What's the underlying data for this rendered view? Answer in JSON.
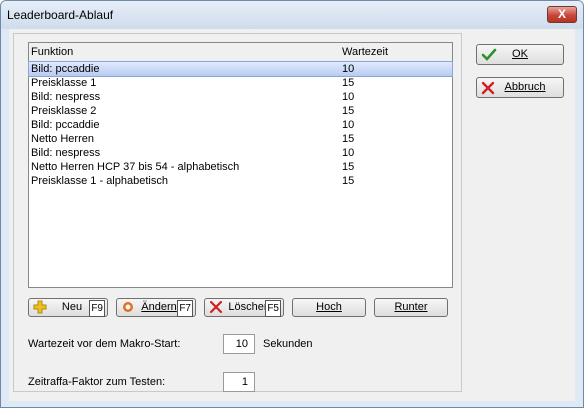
{
  "window": {
    "title": "Leaderboard-Ablauf",
    "close_label": "X"
  },
  "list": {
    "columns": [
      "Funktion",
      "Wartezeit"
    ],
    "rows": [
      {
        "funktion": "Bild: pccaddie",
        "wartezeit": "10",
        "selected": true
      },
      {
        "funktion": "Preisklasse 1",
        "wartezeit": "15"
      },
      {
        "funktion": "Bild: nespress",
        "wartezeit": "10"
      },
      {
        "funktion": "Preisklasse 2",
        "wartezeit": "15"
      },
      {
        "funktion": "Bild: pccaddie",
        "wartezeit": "10"
      },
      {
        "funktion": "Netto Herren",
        "wartezeit": "15"
      },
      {
        "funktion": "Bild: nespress",
        "wartezeit": "10"
      },
      {
        "funktion": "Netto Herren HCP 37 bis 54 - alphabetisch",
        "wartezeit": "15"
      },
      {
        "funktion": "Preisklasse 1 - alphabetisch",
        "wartezeit": "15"
      }
    ]
  },
  "buttons": {
    "neu": "Neu",
    "neu_key": "F9",
    "aendern": "Ändern",
    "aendern_key": "F7",
    "loeschen": "Löscher",
    "loeschen_key": "F5",
    "hoch": "Hoch",
    "runter": "Runter"
  },
  "form": {
    "wartezeit_label": "Wartezeit vor dem Makro-Start:",
    "wartezeit_value": "10",
    "wartezeit_unit": "Sekunden",
    "zeitraffa_label": "Zeitraffa-Faktor zum Testen:",
    "zeitraffa_value": "1"
  },
  "side": {
    "ok": "OK",
    "abbruch": "Abbruch"
  },
  "colors": {
    "selection": "#b9cbf1",
    "ok_check": "#2f8f2f",
    "cancel_x": "#d02020",
    "plus": "#f0c020",
    "edit": "#e07020"
  }
}
